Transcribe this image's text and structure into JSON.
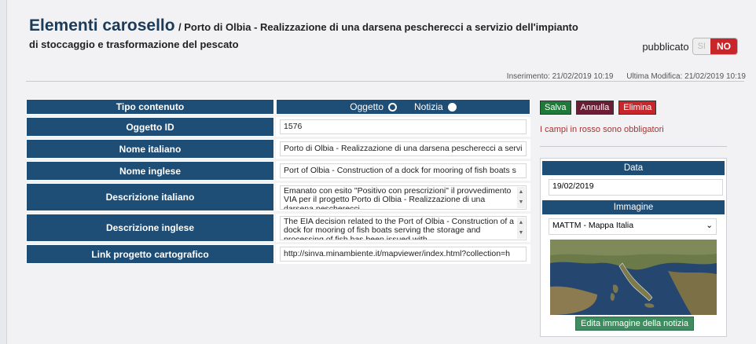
{
  "header": {
    "title": "Elementi carosello",
    "subtitle": "/ Porto di Olbia - Realizzazione di una darsena pescherecci a servizio dell'impianto di stoccaggio e trasformazione del pescato",
    "publish_label": "pubblicato",
    "toggle_off": "SI",
    "toggle_on": "NO"
  },
  "meta": {
    "inserted": "Inserimento: 21/02/2019 10:19",
    "modified": "Ultima Modifica: 21/02/2019 10:19"
  },
  "form": {
    "type_label": "Tipo contenuto",
    "type_option_1": "Oggetto",
    "type_option_2": "Notizia",
    "rows": [
      {
        "label": "Oggetto ID",
        "value": "1576"
      },
      {
        "label": "Nome italiano",
        "value": "Porto di Olbia - Realizzazione di una darsena pescherecci a servi"
      },
      {
        "label": "Nome inglese",
        "value": "Port of Olbia - Construction of a dock for mooring of fish boats s"
      },
      {
        "label": "Descrizione italiano",
        "value": "Emanato con esito \"Positivo con prescrizioni\" il provvedimento VIA per il progetto Porto di Olbia - Realizzazione di una darsena pescherecci"
      },
      {
        "label": "Descrizione inglese",
        "value": "The EIA decision related to the Port of Olbia - Construction of a dock for mooring of fish boats serving the storage and processing of fish has been issued with"
      },
      {
        "label": "Link progetto cartografico",
        "value": "http://sinva.minambiente.it/mapviewer/index.html?collection=h"
      }
    ]
  },
  "actions": {
    "save": "Salva",
    "cancel": "Annulla",
    "delete": "Elimina",
    "required_note": "I campi in rosso sono obbligatori"
  },
  "side": {
    "date_header": "Data",
    "date_value": "19/02/2019",
    "image_header": "Immagine",
    "image_select": "MATTM - Mappa Italia",
    "edit_button": "Edita immagine della notizia"
  }
}
